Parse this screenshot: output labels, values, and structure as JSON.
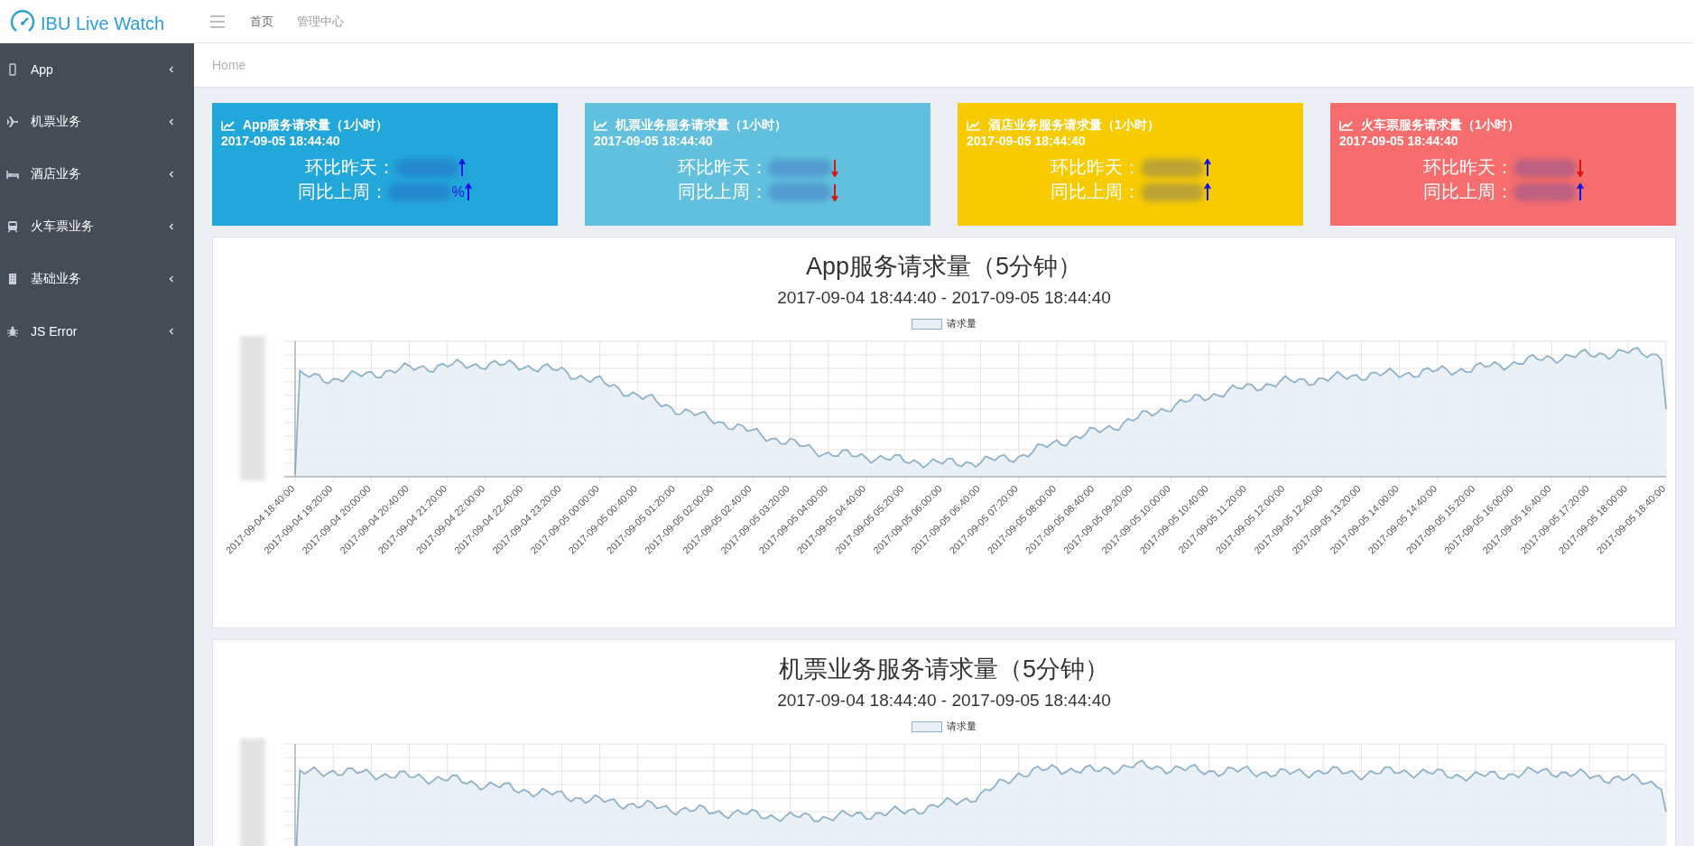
{
  "header": {
    "logo_text": "IBU Live Watch",
    "nav": [
      {
        "label": "首页",
        "selected": true
      },
      {
        "label": "管理中心",
        "selected": false
      }
    ]
  },
  "sidebar": {
    "items": [
      {
        "label": "App",
        "kind": "phone"
      },
      {
        "label": "机票业务",
        "kind": "plane"
      },
      {
        "label": "酒店业务",
        "kind": "bed"
      },
      {
        "label": "火车票业务",
        "kind": "train"
      },
      {
        "label": "基础业务",
        "kind": "building"
      },
      {
        "label": "JS Error",
        "kind": "bug"
      }
    ]
  },
  "breadcrumb": "Home",
  "cards": [
    {
      "title": "App服务请求量（1小时）",
      "time": "2017-09-05 18:44:40",
      "color": "#22a7da",
      "rows": [
        {
          "label": "环比昨天：",
          "rising": true
        },
        {
          "label": "同比上周：",
          "suffix": "%",
          "rising": true
        }
      ]
    },
    {
      "title": "机票业务服务请求量（1小时）",
      "time": "2017-09-05 18:44:40",
      "color": "#61c0dd",
      "rows": [
        {
          "label": "环比昨天：",
          "rising": false
        },
        {
          "label": "同比上周：",
          "rising": false
        }
      ]
    },
    {
      "title": "酒店业务服务请求量（1小时）",
      "time": "2017-09-05 18:44:40",
      "color": "#f7cb00",
      "rows": [
        {
          "label": "环比昨天：",
          "rising": true
        },
        {
          "label": "同比上周：",
          "rising": true
        }
      ]
    },
    {
      "title": "火车票服务请求量（1小时）",
      "time": "2017-09-05 18:44:40",
      "color": "#f76d6d",
      "rows": [
        {
          "label": "环比昨天：",
          "rising": false
        },
        {
          "label": "同比上周：",
          "rising": true
        }
      ]
    }
  ],
  "charts": [
    {
      "title": "App服务请求量（5分钟）",
      "subtitle": "2017-09-04 18:44:40 - 2017-09-05 18:44:40",
      "legend": "请求量",
      "x_labels": [
        "2017-09-04 18:40:00",
        "2017-09-04 19:20:00",
        "2017-09-04 20:00:00",
        "2017-09-04 20:40:00",
        "2017-09-04 21:20:00",
        "2017-09-04 22:00:00",
        "2017-09-04 22:40:00",
        "2017-09-04 23:20:00",
        "2017-09-05 00:00:00",
        "2017-09-05 00:40:00",
        "2017-09-05 01:20:00",
        "2017-09-05 02:00:00",
        "2017-09-05 02:40:00",
        "2017-09-05 03:20:00",
        "2017-09-05 04:00:00",
        "2017-09-05 04:40:00",
        "2017-09-05 05:20:00",
        "2017-09-05 06:00:00",
        "2017-09-05 06:40:00",
        "2017-09-05 07:20:00",
        "2017-09-05 08:00:00",
        "2017-09-05 08:40:00",
        "2017-09-05 09:20:00",
        "2017-09-05 10:00:00",
        "2017-09-05 10:40:00",
        "2017-09-05 11:20:00",
        "2017-09-05 12:00:00",
        "2017-09-05 12:40:00",
        "2017-09-05 13:20:00",
        "2017-09-05 14:00:00",
        "2017-09-05 14:40:00",
        "2017-09-05 15:20:00",
        "2017-09-05 16:00:00",
        "2017-09-05 16:40:00",
        "2017-09-05 17:20:00",
        "2017-09-05 18:00:00",
        "2017-09-05 18:40:00"
      ]
    },
    {
      "title": "机票业务服务请求量（5分钟）",
      "subtitle": "2017-09-04 18:44:40 - 2017-09-05 18:44:40",
      "legend": "请求量"
    }
  ]
}
